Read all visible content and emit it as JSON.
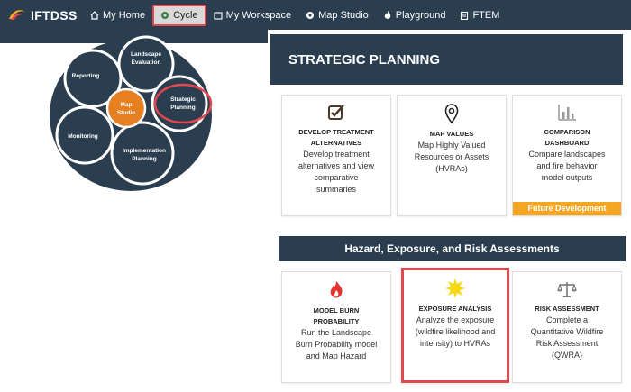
{
  "nav": {
    "logo": "IFTDSS",
    "items": [
      {
        "label": "My Home",
        "icon": "home-icon"
      },
      {
        "label": "Cycle",
        "icon": "cycle-icon"
      },
      {
        "label": "My Workspace",
        "icon": "folder-icon"
      },
      {
        "label": "Map Studio",
        "icon": "map-pin-icon"
      },
      {
        "label": "Playground",
        "icon": "fire-icon"
      },
      {
        "label": "FTEM",
        "icon": "clipboard-icon"
      }
    ],
    "active": "Cycle"
  },
  "cycle": {
    "center": [
      "Map",
      "Studio"
    ],
    "segments": {
      "landscape": [
        "Landscape",
        "Evaluation"
      ],
      "strategic": [
        "Strategic",
        "Planning"
      ],
      "implementation": [
        "Implementation",
        "Planning"
      ],
      "monitoring": [
        "Monitoring"
      ],
      "reporting": [
        "Reporting"
      ]
    },
    "highlight": "Strategic Planning"
  },
  "strategic": {
    "title": "STRATEGIC PLANNING",
    "cards": [
      {
        "icon": "checkbox-edit-icon",
        "title1": "DEVELOP TREATMENT",
        "title2": "ALTERNATIVES",
        "desc": [
          "Develop treatment",
          "alternatives and view",
          "comparative",
          "summaries"
        ]
      },
      {
        "icon": "map-marker-icon",
        "title1": "MAP VALUES",
        "title2": "",
        "desc": [
          "Map Highly Valued",
          "Resources or Assets",
          "(HVRAs)"
        ]
      },
      {
        "icon": "bar-chart-icon",
        "title1": "COMPARISON",
        "title2": "DASHBOARD",
        "desc": [
          "Compare landscapes",
          "and fire behavior",
          "model outputs"
        ],
        "badge": "Future Development"
      }
    ]
  },
  "hazard": {
    "title": "Hazard, Exposure, and Risk Assessments",
    "cards": [
      {
        "icon": "fire-icon",
        "title1": "MODEL BURN",
        "title2": "PROBABILITY",
        "desc": [
          "Run the Landscape",
          "Burn Probability model",
          "and Map Hazard"
        ]
      },
      {
        "icon": "sun-icon",
        "title1": "EXPOSURE ANALYSIS",
        "title2": "",
        "desc": [
          "Analyze the exposure",
          "(wildfire likelihood and",
          "intensity) to HVRAs"
        ]
      },
      {
        "icon": "scales-icon",
        "title1": "RISK ASSESSMENT",
        "title2": "",
        "desc": [
          "Complete a",
          "Quantitative Wildfire",
          "Risk Assessment",
          "(QWRA)"
        ]
      }
    ]
  },
  "colors": {
    "navy": "#2b3e50",
    "orange": "#e67e22",
    "highlight_red": "#e3484f",
    "badge_orange": "#f5a623"
  }
}
